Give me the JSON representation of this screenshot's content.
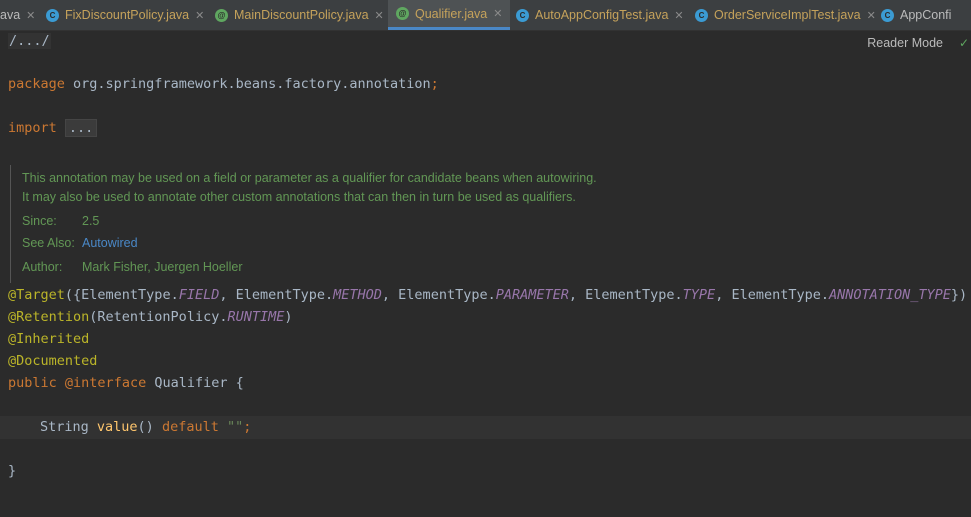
{
  "tabs": [
    {
      "label": "ava",
      "type": "none",
      "active": false
    },
    {
      "label": "FixDiscountPolicy.java",
      "type": "class",
      "active": false
    },
    {
      "label": "MainDiscountPolicy.java",
      "type": "annotation",
      "active": false
    },
    {
      "label": "Qualifier.java",
      "type": "annotation",
      "active": true
    },
    {
      "label": "AutoAppConfigTest.java",
      "type": "class",
      "active": false
    },
    {
      "label": "OrderServiceImplTest.java",
      "type": "class",
      "active": false
    },
    {
      "label": "AppConfi",
      "type": "class",
      "active": false
    }
  ],
  "editor": {
    "reader_mode": "Reader Mode",
    "lines": {
      "header": "/.../",
      "package_kw": "package",
      "package_name": " org.springframework.beans.factory.annotation",
      "semicolon": ";",
      "import_kw": "import",
      "import_fold": "...",
      "target_ann": "@Target",
      "target_open": "({ElementType.",
      "field": "FIELD",
      "sep1": ", ElementType.",
      "method": "METHOD",
      "sep2": ", ElementType.",
      "parameter": "PARAMETER",
      "sep3": ", ElementType.",
      "type": "TYPE",
      "sep4": ", ElementType.",
      "annotation_type": "ANNOTATION_TYPE",
      "target_close": "})",
      "retention_ann": "@Retention",
      "retention_open": "(RetentionPolicy.",
      "runtime": "RUNTIME",
      "retention_close": ")",
      "inherited": "@Inherited",
      "documented": "@Documented",
      "public_kw": "public",
      "interface_kw": "@interface",
      "interface_name": " Qualifier {",
      "string_type": "String ",
      "value_fn": "value",
      "parens": "() ",
      "default_kw": "default",
      "empty_str": "\"\"",
      "stmt_end": ";",
      "close_brace": "}"
    },
    "doc": {
      "line1": "This annotation may be used on a field or parameter as a qualifier for candidate beans when autowiring.",
      "line2": "It may also be used to annotate other custom annotations that can then in turn be used as qualifiers.",
      "since_label": "Since:",
      "since_value": "2.5",
      "see_also_label": "See Also:",
      "see_also_value": "Autowired",
      "author_label": "Author:",
      "author_value": "Mark Fisher, Juergen Hoeller"
    }
  },
  "colors": {
    "background": "#2b2b2b",
    "keyword": "#cc7832",
    "annotation": "#bbb529",
    "constant": "#9876aa",
    "doc": "#629755",
    "link": "#4a88c7"
  }
}
